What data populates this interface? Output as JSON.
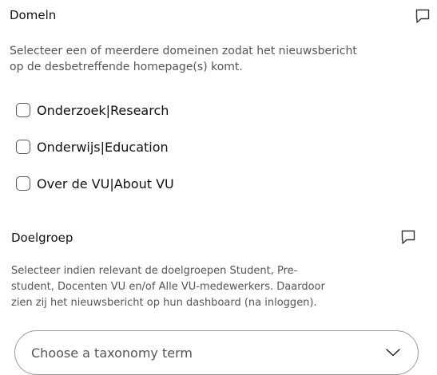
{
  "domein": {
    "title": "Domeln",
    "description_line1": "Selecteer een of meerdere domeinen zodat het nieuwsbericht",
    "description_line2": "op de desbetreffende homepage(s) komt.",
    "options": [
      {
        "label": "Onderzoek|Research",
        "checked": false
      },
      {
        "label": "Onderwijs|Education",
        "checked": false
      },
      {
        "label": "Over de VU|About VU",
        "checked": false
      }
    ]
  },
  "doelgroep": {
    "title": "Doelgroep",
    "description_line1": "Selecteer indien relevant de doelgroepen Student, Pre-",
    "description_line2": "student, Docenten VU en/of Alle VU-medewerkers. Daardoor",
    "description_line3": "zien zij het nieuwsbericht op hun dashboard (na inloggen).",
    "select_placeholder": "Choose a taxonomy term"
  },
  "icons": {
    "comment": "comment-icon",
    "chevron": "chevron-down-icon"
  }
}
